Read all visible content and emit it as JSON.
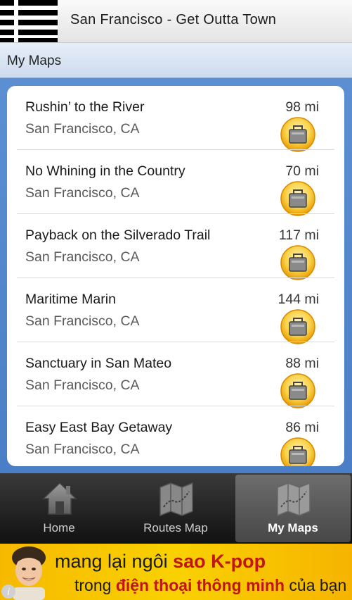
{
  "app": {
    "title": "San Francisco - Get Outta Town"
  },
  "section": {
    "title": "My Maps"
  },
  "maps": [
    {
      "name": "Rushin’ to the River",
      "location": "San Francisco, CA",
      "distance": "98 mi"
    },
    {
      "name": "No Whining in the Country",
      "location": "San Francisco, CA",
      "distance": "70 mi"
    },
    {
      "name": "Payback on the Silverado Trail",
      "location": "San Francisco, CA",
      "distance": "117 mi"
    },
    {
      "name": "Maritime Marin",
      "location": "San Francisco, CA",
      "distance": "144 mi"
    },
    {
      "name": "Sanctuary in San Mateo",
      "location": "San Francisco, CA",
      "distance": "88 mi"
    },
    {
      "name": "Easy East Bay Getaway",
      "location": "San Francisco, CA",
      "distance": "86 mi"
    }
  ],
  "nav": {
    "tabs": [
      {
        "label": "Home",
        "icon": "home-icon"
      },
      {
        "label": "Routes Map",
        "icon": "map-icon"
      },
      {
        "label": "My Maps",
        "icon": "map-icon",
        "active": true
      }
    ]
  },
  "ad": {
    "line1_prefix": "mang lại ngôi ",
    "line1_highlight": "sao K-pop",
    "line2_prefix": "trong ",
    "line2_highlight": "điện thoại thông minh",
    "line2_suffix": " của bạn",
    "info": "i"
  },
  "colors": {
    "panel_blue": "#4a7ec6",
    "badge_orange": "#f5a800",
    "ad_yellow": "#f9d100",
    "ad_highlight": "#c2151a"
  }
}
